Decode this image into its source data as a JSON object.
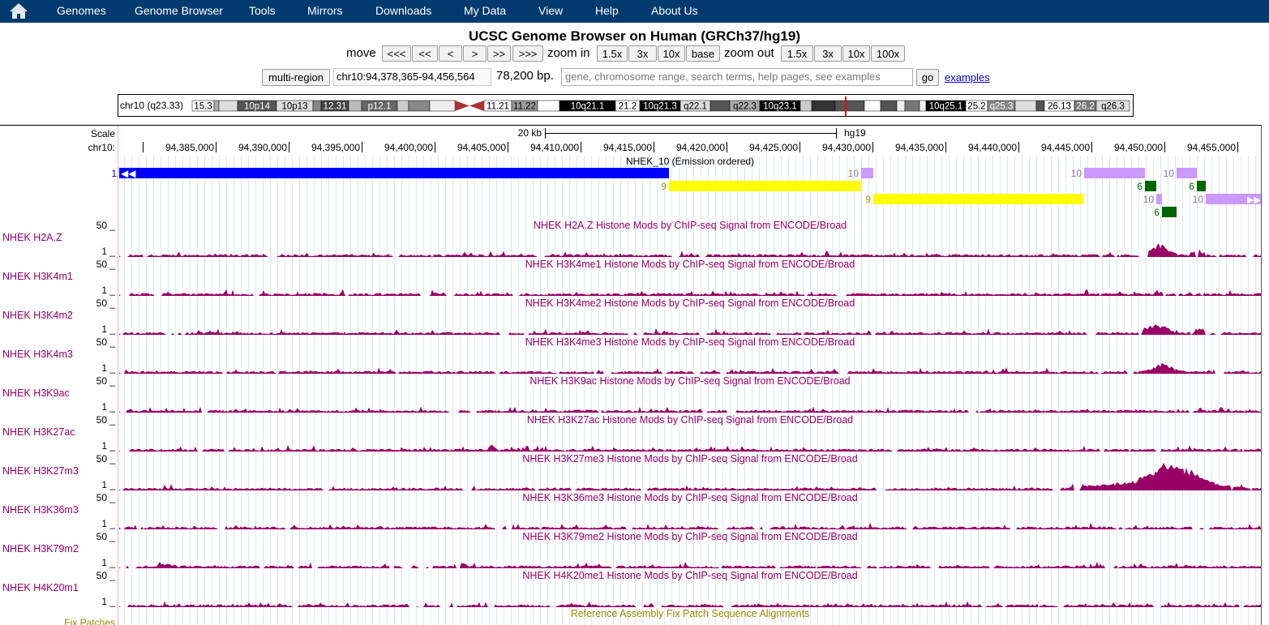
{
  "nav": {
    "items": [
      "Genomes",
      "Genome Browser",
      "Tools",
      "Mirrors",
      "Downloads",
      "My Data",
      "View",
      "Help",
      "About Us"
    ]
  },
  "title": "UCSC Genome Browser on Human (GRCh37/hg19)",
  "move": {
    "label": "move",
    "buttons": [
      "<<<",
      "<<",
      "<",
      ">",
      ">>",
      ">>>"
    ]
  },
  "zoom_in": {
    "label": "zoom in",
    "buttons": [
      "1.5x",
      "3x",
      "10x",
      "base"
    ]
  },
  "zoom_out": {
    "label": "zoom out",
    "buttons": [
      "1.5x",
      "3x",
      "10x",
      "100x"
    ]
  },
  "multi_region_label": "multi-region",
  "position": "chr10:94,378,365-94,456,564",
  "size": "78,200 bp.",
  "search": {
    "placeholder": "gene, chromosome range, search terms, help pages, see examples"
  },
  "go_label": "go",
  "examples_label": "examples",
  "ideogram": {
    "label": "chr10 (q23.33)",
    "bands": [
      "15.3",
      "10p14",
      "10p13",
      "12.31",
      "p12.1",
      "11.21",
      "11.22",
      "10q21.1",
      "21.2",
      "10q21.3",
      "q22.1",
      "q22.3",
      "10q23.1",
      "10q25.1",
      "25.2",
      "q25.3",
      "26.13",
      "26.2",
      "q26.3"
    ]
  },
  "scale": {
    "label": "Scale",
    "size_label": "20 kb",
    "assembly": "hg19",
    "chrom_label": "chr10:",
    "ticks": [
      "94,385,000",
      "94,390,000",
      "94,395,000",
      "94,400,000",
      "94,405,000",
      "94,410,000",
      "94,415,000",
      "94,420,000",
      "94,425,000",
      "94,430,000",
      "94,435,000",
      "94,440,000",
      "94,445,000",
      "94,450,000",
      "94,455,000"
    ]
  },
  "hmm": {
    "title": "NHEK_10 (Emission ordered)",
    "states": [
      {
        "state": "1",
        "color": "#0000ff"
      },
      {
        "state": "10",
        "color": "#cc99ff"
      },
      {
        "state": "9",
        "color": "#ffff00"
      },
      {
        "state": "6",
        "color": "#006400"
      }
    ]
  },
  "tracks": [
    {
      "label": "NHEK H2A.Z",
      "title": "NHEK H2A.Z Histone Mods by ChIP-seq Signal from ENCODE/Broad",
      "max": "50",
      "min": "1"
    },
    {
      "label": "NHEK H3K4m1",
      "title": "NHEK H3K4me1 Histone Mods by ChIP-seq Signal from ENCODE/Broad",
      "max": "50",
      "min": "1"
    },
    {
      "label": "NHEK H3K4m2",
      "title": "NHEK H3K4me2 Histone Mods by ChIP-seq Signal from ENCODE/Broad",
      "max": "50",
      "min": "1"
    },
    {
      "label": "NHEK H3K4m3",
      "title": "NHEK H3K4me3 Histone Mods by ChIP-seq Signal from ENCODE/Broad",
      "max": "50",
      "min": "1"
    },
    {
      "label": "NHEK H3K9ac",
      "title": "NHEK H3K9ac Histone Mods by ChIP-seq Signal from ENCODE/Broad",
      "max": "50",
      "min": "1"
    },
    {
      "label": "NHEK H3K27ac",
      "title": "NHEK H3K27ac Histone Mods by ChIP-seq Signal from ENCODE/Broad",
      "max": "50",
      "min": "1"
    },
    {
      "label": "NHEK H3K27m3",
      "title": "NHEK H3K27me3 Histone Mods by ChIP-seq Signal from ENCODE/Broad",
      "max": "50",
      "min": "1"
    },
    {
      "label": "NHEK H3K36m3",
      "title": "NHEK H3K36me3 Histone Mods by ChIP-seq Signal from ENCODE/Broad",
      "max": "50",
      "min": "1"
    },
    {
      "label": "NHEK H3K79m2",
      "title": "NHEK H3K79me2 Histone Mods by ChIP-seq Signal from ENCODE/Broad",
      "max": "50",
      "min": "1"
    },
    {
      "label": "NHEK H4K20m1",
      "title": "NHEK H4K20me1 Histone Mods by ChIP-seq Signal from ENCODE/Broad",
      "max": "50",
      "min": "1"
    }
  ],
  "fix_patches": {
    "label": "Fix Patches",
    "title": "Reference Assembly Fix Patch Sequence Alignments"
  },
  "colors": {
    "navbar": "#003a6e",
    "signal": "#990066",
    "hmm_blue": "#0000ff",
    "hmm_lilac": "#cc99ff",
    "hmm_yellow": "#ffff00",
    "hmm_green": "#006400",
    "fix_patch": "#998800"
  }
}
